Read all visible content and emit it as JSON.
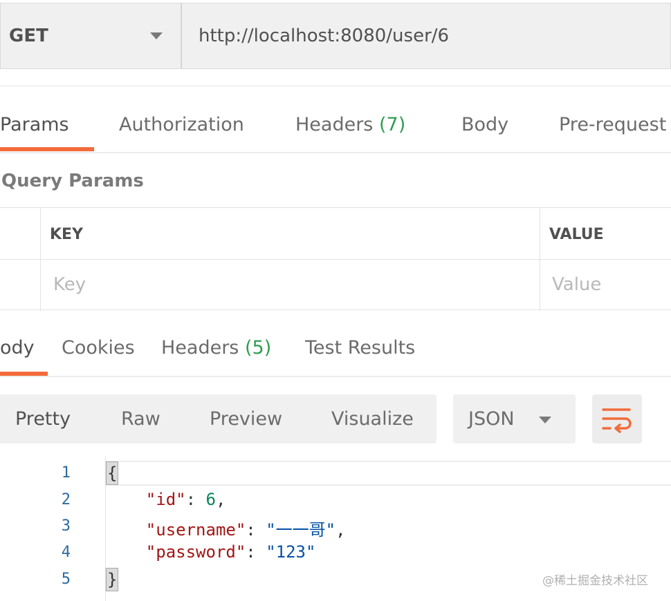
{
  "request": {
    "method": "GET",
    "url": "http://localhost:8080/user/6"
  },
  "request_tabs": {
    "params": "Params",
    "authorization": "Authorization",
    "headers_label": "Headers",
    "headers_count": "(7)",
    "body": "Body",
    "pre_request": "Pre-request"
  },
  "query_params": {
    "title": "Query Params",
    "key_header": "KEY",
    "value_header": "VALUE",
    "key_placeholder": "Key",
    "value_placeholder": "Value"
  },
  "response_tabs": {
    "body": "ody",
    "cookies": "Cookies",
    "headers_label": "Headers",
    "headers_count": "(5)",
    "test_results": "Test Results"
  },
  "format": {
    "options": [
      "Pretty",
      "Raw",
      "Preview",
      "Visualize"
    ],
    "active": "Pretty",
    "language": "JSON",
    "wrap_icon": "wrap-lines-icon"
  },
  "code": {
    "line_numbers": [
      "1",
      "2",
      "3",
      "4",
      "5"
    ],
    "open_brace": "{",
    "close_brace": "}",
    "id_key": "\"id\"",
    "id_value": "6",
    "username_key": "\"username\"",
    "username_value": "\"一一哥\"",
    "password_key": "\"password\"",
    "password_value": "\"123\""
  },
  "colors": {
    "accent": "#f26b3a",
    "count_green": "#2e9e4f",
    "json_key": "#a31515",
    "json_string": "#0451a5",
    "json_number": "#098658"
  },
  "watermark": "@稀土掘金技术社区"
}
